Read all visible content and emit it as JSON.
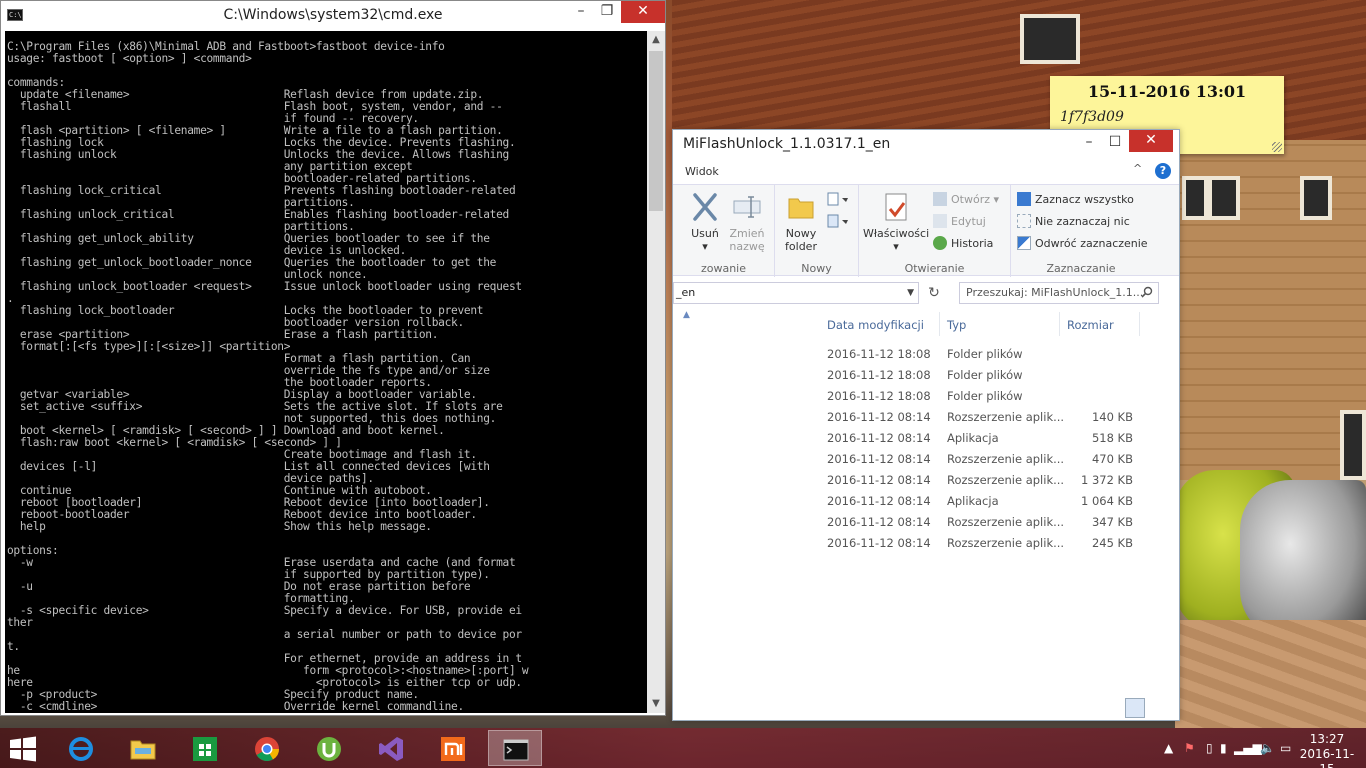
{
  "wallpaper_note": {
    "date": "15-11-2016 13:01",
    "text": "1f7f3d09"
  },
  "cmd": {
    "title": "C:\\Windows\\system32\\cmd.exe",
    "minimize": "–",
    "maximize": "❐",
    "close": "✕",
    "lines": [
      "C:\\Program Files (x86)\\Minimal ADB and Fastboot>fastboot device-info",
      "usage: fastboot [ <option> ] <command>",
      "",
      "commands:",
      "  update <filename>                        Reflash device from update.zip.",
      "  flashall                                 Flash boot, system, vendor, and --",
      "                                           if found -- recovery.",
      "  flash <partition> [ <filename> ]         Write a file to a flash partition.",
      "  flashing lock                            Locks the device. Prevents flashing.",
      "  flashing unlock                          Unlocks the device. Allows flashing",
      "                                           any partition except",
      "                                           bootloader-related partitions.",
      "  flashing lock_critical                   Prevents flashing bootloader-related",
      "                                           partitions.",
      "  flashing unlock_critical                 Enables flashing bootloader-related",
      "                                           partitions.",
      "  flashing get_unlock_ability              Queries bootloader to see if the",
      "                                           device is unlocked.",
      "  flashing get_unlock_bootloader_nonce     Queries the bootloader to get the",
      "                                           unlock nonce.",
      "  flashing unlock_bootloader <request>     Issue unlock bootloader using request",
      ".",
      "  flashing lock_bootloader                 Locks the bootloader to prevent",
      "                                           bootloader version rollback.",
      "  erase <partition>                        Erase a flash partition.",
      "  format[:[<fs type>][:[<size>]] <partition>",
      "                                           Format a flash partition. Can",
      "                                           override the fs type and/or size",
      "                                           the bootloader reports.",
      "  getvar <variable>                        Display a bootloader variable.",
      "  set_active <suffix>                      Sets the active slot. If slots are",
      "                                           not supported, this does nothing.",
      "  boot <kernel> [ <ramdisk> [ <second> ] ] Download and boot kernel.",
      "  flash:raw boot <kernel> [ <ramdisk> [ <second> ] ]",
      "                                           Create bootimage and flash it.",
      "  devices [-l]                             List all connected devices [with",
      "                                           device paths].",
      "  continue                                 Continue with autoboot.",
      "  reboot [bootloader]                      Reboot device [into bootloader].",
      "  reboot-bootloader                        Reboot device into bootloader.",
      "  help                                     Show this help message.",
      "",
      "options:",
      "  -w                                       Erase userdata and cache (and format",
      "                                           if supported by partition type).",
      "  -u                                       Do not erase partition before",
      "                                           formatting.",
      "  -s <specific device>                     Specify a device. For USB, provide ei",
      "ther",
      "                                           a serial number or path to device por",
      "t.",
      "                                           For ethernet, provide an address in t",
      "he                                            form <protocol>:<hostname>[:port] w",
      "here                                            <protocol> is either tcp or udp.",
      "  -p <product>                             Specify product name.",
      "  -c <cmdline>                             Override kernel commandline."
    ],
    "scroll_up": "▲",
    "scroll_down": "▼"
  },
  "explorer": {
    "title": "MiFlashUnlock_1.1.0317.1_en",
    "minimize": "–",
    "maximize": "☐",
    "close": "✕",
    "tab": "Widok",
    "collapse": "^",
    "help": "?",
    "ribbon": {
      "organize_label": "zowanie",
      "delete": "Usuń",
      "rename_line1": "Zmień",
      "rename_line2": "nazwę",
      "new_label": "Nowy",
      "new_folder_line1": "Nowy",
      "new_folder_line2": "folder",
      "open_label": "Otwieranie",
      "properties": "Właściwości",
      "open": "Otwórz",
      "edit": "Edytuj",
      "history": "Historia",
      "select_label": "Zaznaczanie",
      "select_all": "Zaznacz wszystko",
      "select_none": "Nie zaznaczaj nic",
      "invert": "Odwróć zaznaczenie"
    },
    "address": "_en",
    "search_placeholder": "Przeszukaj: MiFlashUnlock_1.1...",
    "columns": {
      "date": "Data modyfikacji",
      "type": "Typ",
      "size": "Rozmiar"
    },
    "rows": [
      {
        "date": "2016-11-12 18:08",
        "type": "Folder plików",
        "size": ""
      },
      {
        "date": "2016-11-12 18:08",
        "type": "Folder plików",
        "size": ""
      },
      {
        "date": "2016-11-12 18:08",
        "type": "Folder plików",
        "size": ""
      },
      {
        "date": "2016-11-12 08:14",
        "type": "Rozszerzenie aplik...",
        "size": "140 KB"
      },
      {
        "date": "2016-11-12 08:14",
        "type": "Aplikacja",
        "size": "518 KB"
      },
      {
        "date": "2016-11-12 08:14",
        "type": "Rozszerzenie aplik...",
        "size": "470 KB"
      },
      {
        "date": "2016-11-12 08:14",
        "type": "Rozszerzenie aplik...",
        "size": "1 372 KB"
      },
      {
        "date": "2016-11-12 08:14",
        "type": "Aplikacja",
        "size": "1 064 KB"
      },
      {
        "date": "2016-11-12 08:14",
        "type": "Rozszerzenie aplik...",
        "size": "347 KB"
      },
      {
        "date": "2016-11-12 08:14",
        "type": "Rozszerzenie aplik...",
        "size": "245 KB"
      }
    ]
  },
  "taskbar": {
    "apps": [
      "ie-icon",
      "file-explorer-icon",
      "store-icon",
      "chrome-icon",
      "utorrent-icon",
      "visual-studio-icon",
      "mi-icon",
      "cmd-icon"
    ],
    "clock_time": "13:27",
    "clock_date": "2016-11-15"
  },
  "colors": {
    "close_red": "#c7312b",
    "link_blue": "#4a6a9a",
    "sticky_yellow": "#fdf59a"
  }
}
